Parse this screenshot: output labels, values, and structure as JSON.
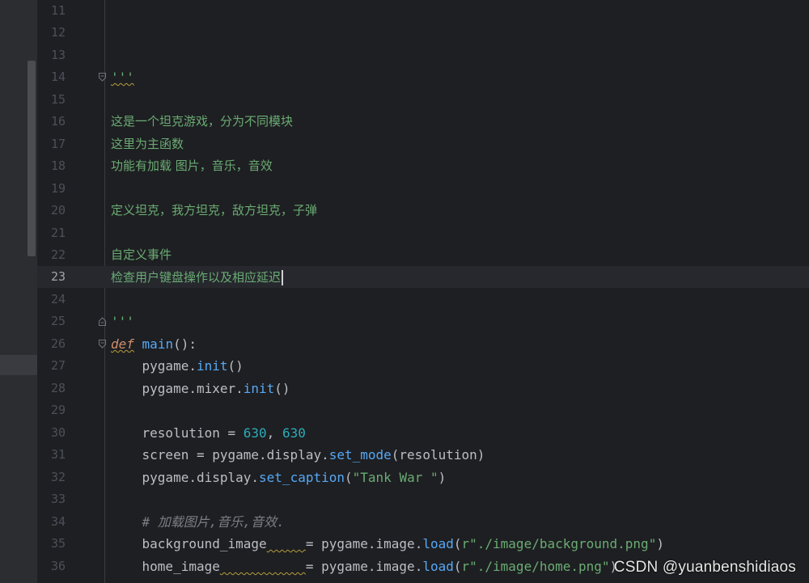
{
  "editor": {
    "lines": [
      {
        "num": "11",
        "text": ""
      },
      {
        "num": "12",
        "text": ""
      },
      {
        "num": "13",
        "text": ""
      },
      {
        "num": "14",
        "text": "'''"
      },
      {
        "num": "15",
        "text": ""
      },
      {
        "num": "16",
        "text": "这是一个坦克游戏，分为不同模块"
      },
      {
        "num": "17",
        "text": "这里为主函数"
      },
      {
        "num": "18",
        "text": "功能有加载 图片，音乐，音效"
      },
      {
        "num": "19",
        "text": ""
      },
      {
        "num": "20",
        "text": "定义坦克，我方坦克，敌方坦克，子弹"
      },
      {
        "num": "21",
        "text": ""
      },
      {
        "num": "22",
        "text": "自定义事件"
      },
      {
        "num": "23",
        "text": "检查用户键盘操作以及相应延迟"
      },
      {
        "num": "24",
        "text": ""
      },
      {
        "num": "25",
        "text": "'''"
      },
      {
        "num": "26",
        "text": "def main():"
      },
      {
        "num": "27",
        "text": "    pygame.init()"
      },
      {
        "num": "28",
        "text": "    pygame.mixer.init()"
      },
      {
        "num": "29",
        "text": ""
      },
      {
        "num": "30",
        "text": "    resolution = 630, 630"
      },
      {
        "num": "31",
        "text": "    screen = pygame.display.set_mode(resolution)"
      },
      {
        "num": "32",
        "text": "    pygame.display.set_caption(\"Tank War \")"
      },
      {
        "num": "33",
        "text": ""
      },
      {
        "num": "34",
        "text": "    # 加载图片,音乐,音效."
      },
      {
        "num": "35",
        "text": "    background_image = pygame.image.load(r\"./image/background.png\")"
      },
      {
        "num": "36",
        "text": "    home_image = pygame.image.load(r\"./image/home.png\")"
      }
    ],
    "current_line": "23"
  },
  "tokens": {
    "l26_kw": "def",
    "l26_fn": "main",
    "l26_rest": "():",
    "l27_a": "    pygame.",
    "l27_b": "init",
    "l27_c": "()",
    "l28_a": "    pygame.mixer.",
    "l28_b": "init",
    "l28_c": "()",
    "l30_a": "    resolution = ",
    "l30_b": "630",
    "l30_c": ", ",
    "l30_d": "630",
    "l31_a": "    screen = pygame.display.",
    "l31_b": "set_mode",
    "l31_c": "(resolution)",
    "l32_a": "    pygame.display.",
    "l32_b": "set_caption",
    "l32_c": "(",
    "l32_d": "\"Tank War \"",
    "l32_e": ")",
    "l34": "    # 加载图片,音乐,音效.",
    "l35_a": "    background_image",
    "l35_pad": "     ",
    "l35_b": "= pygame.image.",
    "l35_c": "load",
    "l35_d": "(",
    "l35_e": "r\"./image/background.png\"",
    "l35_f": ")",
    "l36_a": "    home_image",
    "l36_pad": "           ",
    "l36_b": "= pygame.image.",
    "l36_c": "load",
    "l36_d": "(",
    "l36_e": "r\"./image/home.png\"",
    "l36_f": ")"
  },
  "watermark": "CSDN @yuanbenshidiaos",
  "colors": {
    "editor_bg": "#1e1f22",
    "docstring": "#6aab73",
    "keyword": "#cf8e6d",
    "function": "#56a8f5",
    "number": "#2aacb8",
    "comment": "#7a7e85"
  }
}
